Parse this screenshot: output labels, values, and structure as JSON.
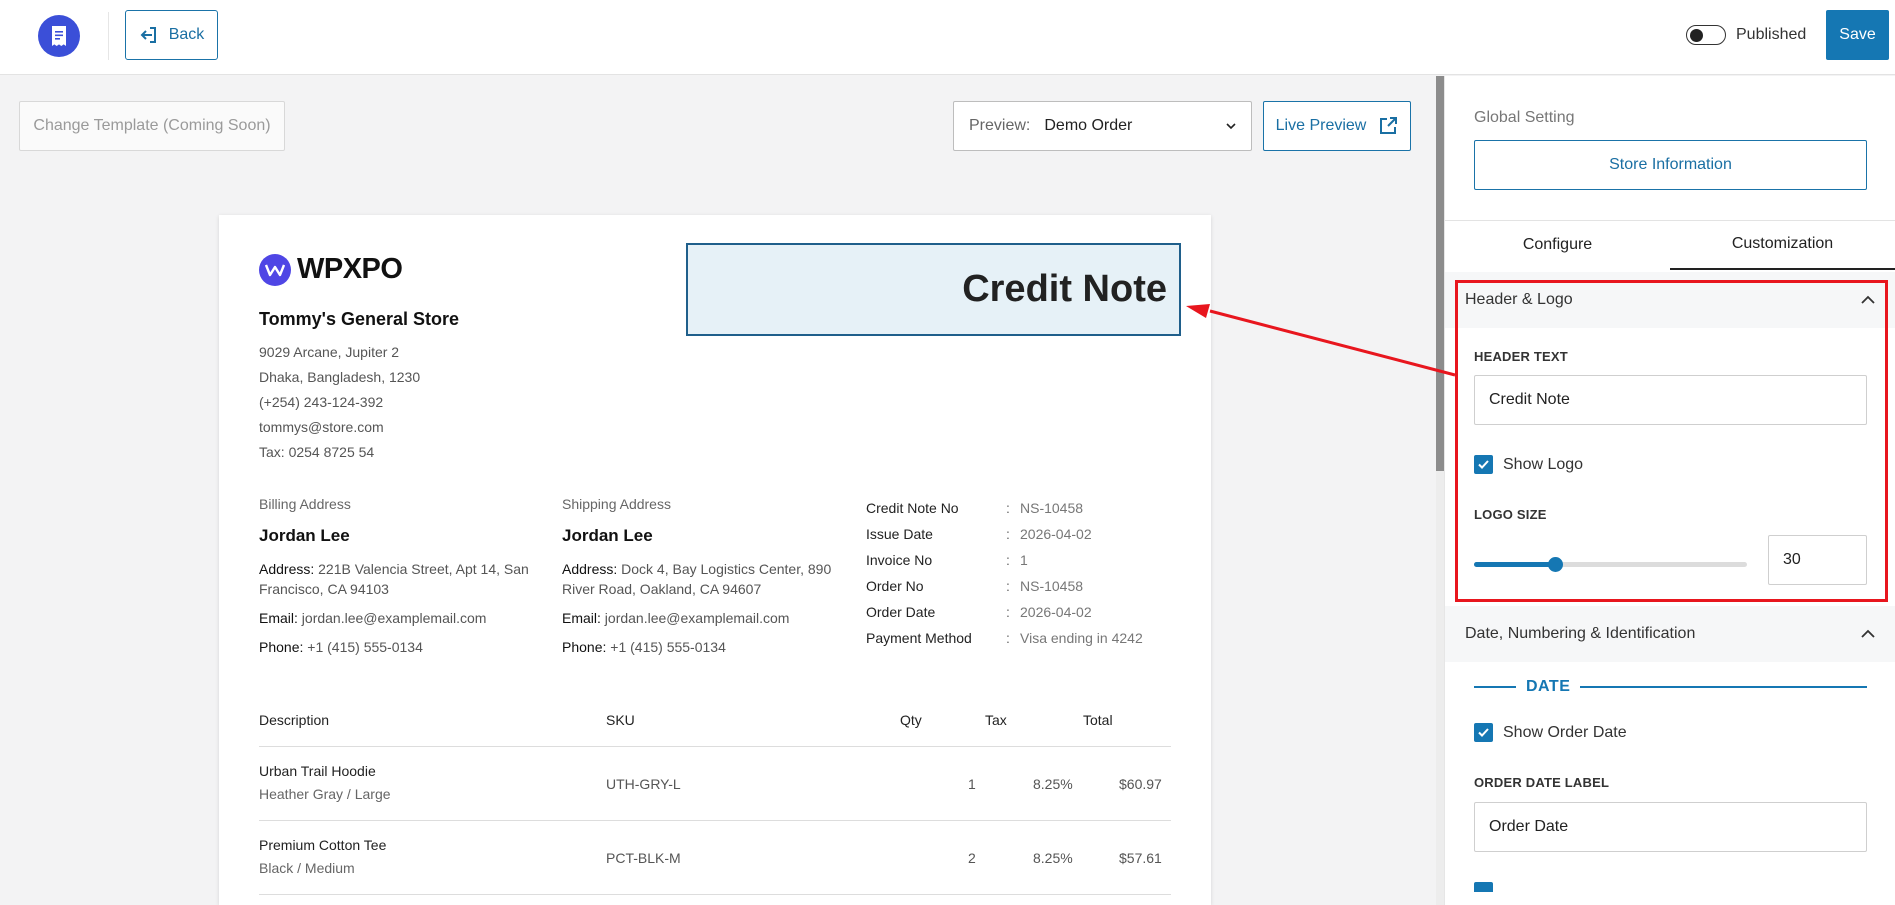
{
  "topbar": {
    "logo_icon": "receipt-icon",
    "back_label": "Back",
    "published_label": "Published",
    "published_on": false,
    "save_label": "Save"
  },
  "toolbar": {
    "change_template_label": "Change Template (Coming Soon)",
    "preview_label": "Preview:",
    "preview_value": "Demo Order",
    "live_preview_label": "Live Preview"
  },
  "document": {
    "brand": "WPXPO",
    "header_text": "Credit Note",
    "store": {
      "name": "Tommy's General Store",
      "lines": [
        "9029 Arcane, Jupiter 2",
        "Dhaka, Bangladesh, 1230",
        "(+254) 243-124-392",
        "tommys@store.com",
        "Tax: 0254 8725 54"
      ]
    },
    "billing": {
      "title": "Billing Address",
      "name": "Jordan Lee",
      "address_label": "Address:",
      "address_value": "221B Valencia Street, Apt 14, San Francisco, CA 94103",
      "email_label": "Email:",
      "email_value": "jordan.lee@examplemail.com",
      "phone_label": "Phone:",
      "phone_value": "+1 (415) 555-0134"
    },
    "shipping": {
      "title": "Shipping Address",
      "name": "Jordan Lee",
      "address_label": "Address:",
      "address_value": "Dock 4, Bay Logistics Center, 890 River Road, Oakland, CA 94607",
      "email_label": "Email:",
      "email_value": "jordan.lee@examplemail.com",
      "phone_label": "Phone:",
      "phone_value": "+1 (415) 555-0134"
    },
    "meta": [
      {
        "k": "Credit Note No",
        "v": "NS-10458"
      },
      {
        "k": "Issue Date",
        "v": "2026-04-02"
      },
      {
        "k": "Invoice No",
        "v": "1"
      },
      {
        "k": "Order No",
        "v": "NS-10458"
      },
      {
        "k": "Order Date",
        "v": "2026-04-02"
      },
      {
        "k": "Payment Method",
        "v": "Visa ending in 4242"
      }
    ],
    "table": {
      "headers": {
        "description": "Description",
        "sku": "SKU",
        "qty": "Qty",
        "tax": "Tax",
        "total": "Total"
      },
      "rows": [
        {
          "name": "Urban Trail Hoodie",
          "variant": "Heather Gray / Large",
          "sku": "UTH-GRY-L",
          "qty": "1",
          "tax": "8.25%",
          "total": "$60.97"
        },
        {
          "name": "Premium Cotton Tee",
          "variant": "Black / Medium",
          "sku": "PCT-BLK-M",
          "qty": "2",
          "tax": "8.25%",
          "total": "$57.61"
        }
      ]
    }
  },
  "panel": {
    "global_setting_label": "Global Setting",
    "store_info_label": "Store Information",
    "tabs": [
      {
        "label": "Configure",
        "active": false
      },
      {
        "label": "Customization",
        "active": true
      }
    ],
    "header_logo": {
      "title": "Header & Logo",
      "header_text_label": "HEADER TEXT",
      "header_text_value": "Credit Note",
      "show_logo_label": "Show Logo",
      "show_logo_checked": true,
      "logo_size_label": "LOGO SIZE",
      "logo_size_value": "30",
      "logo_size_fraction": 0.3
    },
    "date_section": {
      "title": "Date, Numbering & Identification",
      "group_title": "DATE",
      "show_order_date_label": "Show Order Date",
      "show_order_date_checked": true,
      "order_date_label_caption": "ORDER DATE LABEL",
      "order_date_label_value": "Order Date"
    }
  },
  "colors": {
    "accent": "#1577b3",
    "brand": "#3b4fd8",
    "highlight": "#e8161e",
    "header_fill": "#e6f1f7"
  }
}
